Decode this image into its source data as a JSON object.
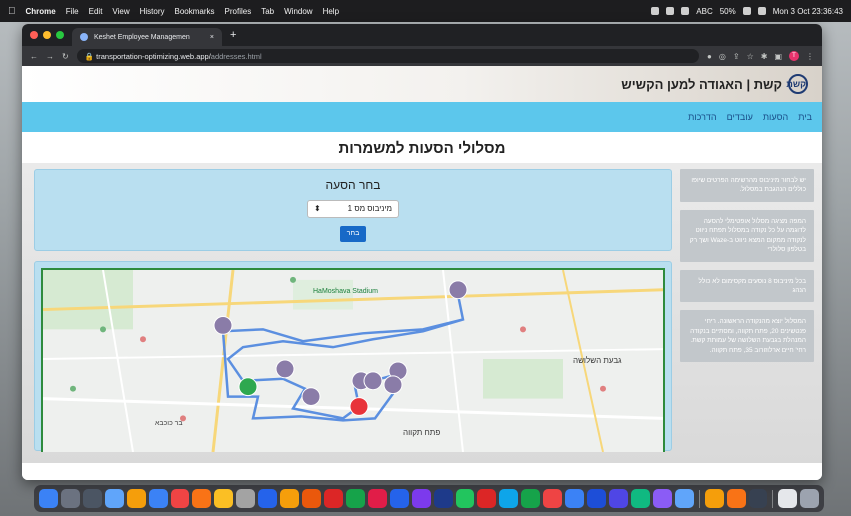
{
  "menubar": {
    "app_name": "Chrome",
    "items": [
      "File",
      "Edit",
      "View",
      "History",
      "Bookmarks",
      "Profiles",
      "Tab",
      "Window",
      "Help"
    ],
    "battery": "50%",
    "keyboard": "ABC",
    "datetime": "Mon 3 Oct  23:36:43"
  },
  "browser": {
    "tab_title": "Keshet Employee Managemen",
    "url_host": "transportation-optimizing.web.app/",
    "url_path": "addresses.html",
    "profile_initial": "T"
  },
  "site": {
    "logo_text": "קשת",
    "brand": "קשת | האגודה למען הקשיש",
    "nav": [
      "בית",
      "הסעות",
      "עובדים",
      "הדרכות"
    ],
    "page_title": "מסלולי הסעות למשמרות"
  },
  "select_panel": {
    "label": "בחר הסעה",
    "selected": "מיניבוס מס 1",
    "button": "בחר"
  },
  "map": {
    "labels": {
      "stadium": "HaMoshava Stadium",
      "givat": "גבעת השלושה",
      "petah": "פתח תקווה",
      "bar_kochba": "בר כוכבא"
    }
  },
  "tips": [
    "יש לבחור מיניבוס מהרשימה הפרטים שיופו כוללים הנהגבת במסלול.",
    "המפה מציגה מסלול אופטימלי להסעה לדוגמה על כל נקודה במסלול תפתח ניווט לנקודה ממקום המצא ניווט ב-Waze ושך רק בטלפון סלולרי",
    "בכל מיניבוס 8 נוסעים מקסימום לא כולל הנהג",
    "המסלול יוצא מהנקודה הראשונה. ריחי פנטשינים 20, פתח תקווה, ומסתיים בנקודה המנהלת בגבעת השלושה של עמותת קשת. רחי' חיים ארלוזורוב 35, פתח תקווה."
  ],
  "colors": {
    "nav_bar": "#5cc7ec",
    "panel_bg": "#b9dff0",
    "button": "#1769c7",
    "route": "#5b8fe0",
    "map_border": "#2e8b3d"
  }
}
